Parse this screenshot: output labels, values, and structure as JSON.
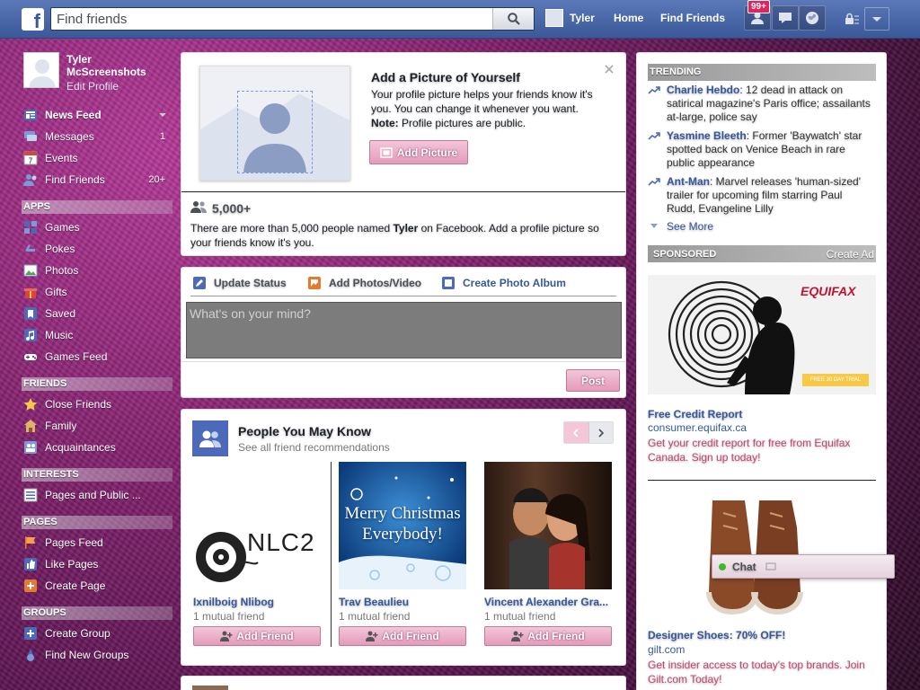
{
  "topbar": {
    "search_placeholder": "Find friends",
    "user_name": "Tyler",
    "home": "Home",
    "find_friends": "Find Friends",
    "notif_count": "99+"
  },
  "profile": {
    "name": "Tyler McScreenshots",
    "edit": "Edit Profile"
  },
  "nav": {
    "main": [
      {
        "label": "News Feed",
        "count": ""
      },
      {
        "label": "Messages",
        "count": "1"
      },
      {
        "label": "Events",
        "count": ""
      },
      {
        "label": "Find Friends",
        "count": "20+"
      }
    ],
    "apps_title": "APPS",
    "apps": [
      "Games",
      "Pokes",
      "Photos",
      "Gifts",
      "Saved",
      "Music",
      "Games Feed"
    ],
    "friends_title": "FRIENDS",
    "friends": [
      "Close Friends",
      "Family",
      "Acquaintances"
    ],
    "interests_title": "INTERESTS",
    "interests": [
      "Pages and Public ..."
    ],
    "pages_title": "PAGES",
    "pages": [
      "Pages Feed",
      "Like Pages",
      "Create Page"
    ],
    "groups_title": "GROUPS",
    "groups": [
      "Create Group",
      "Find New Groups"
    ]
  },
  "picture_card": {
    "title": "Add a Picture of Yourself",
    "body": "Your profile picture helps your friends know it's you. You can change it whenever you want.",
    "note_label": "Note:",
    "note": " Profile pictures are public.",
    "button": "Add Picture",
    "count": "5,000+",
    "desc_pre": "There are more than 5,000 people named ",
    "desc_name": "Tyler",
    "desc_post": " on Facebook. Add a profile picture so your friends know it's you."
  },
  "composer": {
    "tab_status": "Update Status",
    "tab_photo": "Add Photos/Video",
    "tab_album": "Create Photo Album",
    "placeholder": "What's on your mind?",
    "post": "Post"
  },
  "pymk": {
    "title": "People You May Know",
    "subtitle": "See all friend recommendations",
    "add_label": "Add Friend",
    "people": [
      {
        "name": "Ixnilboig Nlibog",
        "mutual": "1 mutual friend"
      },
      {
        "name": "Trav Beaulieu",
        "mutual": "1 mutual friend"
      },
      {
        "name": "Vincent Alexander Gra...",
        "mutual": "1 mutual friend"
      }
    ],
    "nlc_text": "NLC2",
    "xmas_line1": "Merry Christmas",
    "xmas_line2": "Everybody!"
  },
  "trending": {
    "title": "TRENDING",
    "items": [
      {
        "name": "Charlie Hebdo",
        "text": ": 12 dead in attack on satirical magazine's Paris office; assailants at-large, police say"
      },
      {
        "name": "Yasmine Bleeth",
        "text": ": Former 'Baywatch' star spotted back on Venice Beach in rare public appearance"
      },
      {
        "name": "Ant-Man",
        "text": ": Marvel releases 'human-sized' trailer for upcoming film starring Paul Rudd, Evangeline Lilly"
      }
    ],
    "see_more": "See More"
  },
  "sponsored": {
    "title": "SPONSORED",
    "create_ad": "Create Ad",
    "ads": [
      {
        "brand": "EQUIFAX",
        "banner": "FREE 30 DAY TRIAL",
        "title": "Free Credit Report",
        "domain": "consumer.equifax.ca",
        "text": "Get your credit report for free from Equifax Canada. Sign up today!"
      },
      {
        "title": "Designer Shoes: 70% OFF!",
        "domain": "gilt.com",
        "text": "Get insider access to today's top brands. Join Gilt.com Today!"
      }
    ]
  },
  "chat": {
    "label": "Chat"
  },
  "colors": {
    "facebook_blue": "#3b5998",
    "link": "#365899",
    "pink_button": "#e49bbb",
    "notif_red": "#e0245e"
  }
}
